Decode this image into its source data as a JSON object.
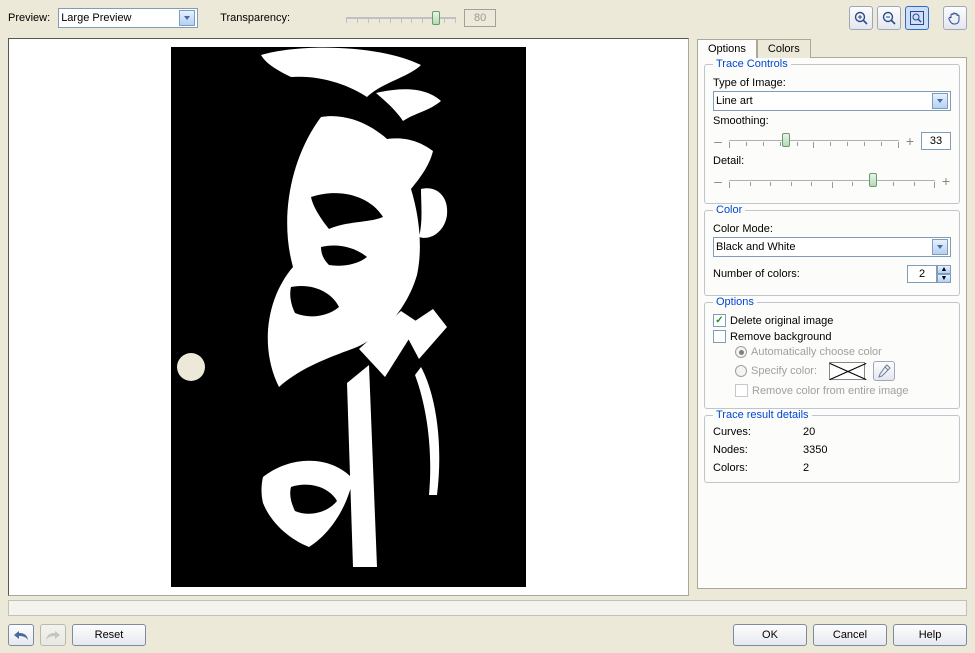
{
  "toolbar": {
    "preview_label": "Preview:",
    "preview_mode": "Large Preview",
    "transparency_label": "Transparency:",
    "transparency_value": "80"
  },
  "tabs": {
    "options": "Options",
    "colors": "Colors"
  },
  "trace_controls": {
    "legend": "Trace Controls",
    "type_label": "Type of Image:",
    "type_value": "Line art",
    "smoothing_label": "Smoothing:",
    "smoothing_value": "33",
    "detail_label": "Detail:"
  },
  "color": {
    "legend": "Color",
    "mode_label": "Color Mode:",
    "mode_value": "Black and White",
    "num_label": "Number of colors:",
    "num_value": "2"
  },
  "options": {
    "legend": "Options",
    "delete_original": "Delete original image",
    "remove_bg": "Remove background",
    "auto_color": "Automatically choose color",
    "specify_color": "Specify color:",
    "remove_entire": "Remove color from entire image"
  },
  "details": {
    "legend": "Trace result details",
    "curves_label": "Curves:",
    "curves_value": "20",
    "nodes_label": "Nodes:",
    "nodes_value": "3350",
    "colors_label": "Colors:",
    "colors_value": "2"
  },
  "buttons": {
    "reset": "Reset",
    "ok": "OK",
    "cancel": "Cancel",
    "help": "Help"
  }
}
